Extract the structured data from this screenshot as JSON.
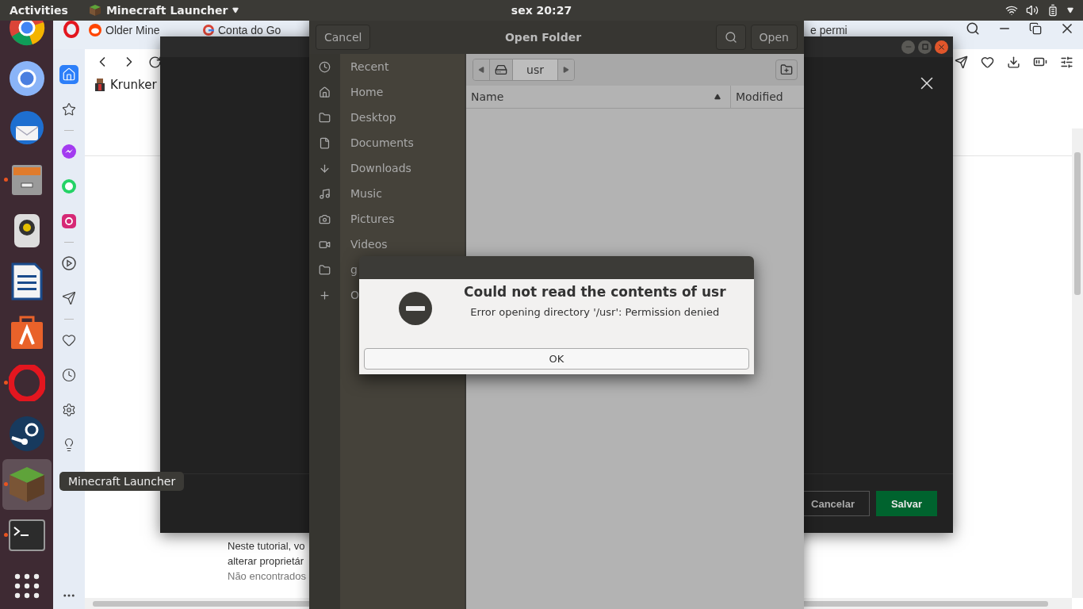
{
  "top_bar": {
    "activities": "Activities",
    "app_menu": "Minecraft Launcher",
    "clock": "sex 20:27"
  },
  "dock": {
    "apps": [
      {
        "kind": "chrome",
        "running": false,
        "selected": false
      },
      {
        "kind": "chromium",
        "running": false,
        "selected": false
      },
      {
        "kind": "mail",
        "running": false,
        "selected": false
      },
      {
        "kind": "files",
        "running": true,
        "selected": false
      },
      {
        "kind": "speaker",
        "running": false,
        "selected": false
      },
      {
        "kind": "writer",
        "running": false,
        "selected": false
      },
      {
        "kind": "store",
        "running": false,
        "selected": false
      },
      {
        "kind": "opera",
        "running": true,
        "selected": false
      },
      {
        "kind": "steam",
        "running": false,
        "selected": false
      },
      {
        "kind": "grass",
        "running": true,
        "selected": true
      },
      {
        "kind": "terminal",
        "running": true,
        "selected": false
      },
      {
        "kind": "grid",
        "running": false,
        "selected": false
      }
    ],
    "tooltip": "Minecraft Launcher"
  },
  "browser": {
    "tabs": [
      {
        "title": "Older Mine",
        "kind": "reddit"
      },
      {
        "title": "Conta do Go",
        "kind": "google"
      },
      {
        "title": "e permi",
        "kind": "plain"
      }
    ],
    "bookmark": "Krunker",
    "sidebar_groups": [
      [
        {
          "kind": "home",
          "selected": true
        },
        {
          "kind": "star",
          "selected": false
        }
      ],
      [
        {
          "kind": "messenger",
          "selected": false
        },
        {
          "kind": "whatsapp",
          "selected": false
        },
        {
          "kind": "instagram",
          "selected": false
        }
      ],
      [
        {
          "kind": "play",
          "selected": false
        },
        {
          "kind": "send",
          "selected": false
        }
      ],
      [
        {
          "kind": "heart",
          "selected": false
        },
        {
          "kind": "clock",
          "selected": false
        },
        {
          "kind": "gear",
          "selected": false
        },
        {
          "kind": "bulb",
          "selected": false
        }
      ]
    ],
    "article_lines": [
      "Neste tutorial, vo",
      "alterar proprietár",
      "Não encontrados"
    ]
  },
  "launcher_dialog": {
    "buttons": [
      {
        "label": "Cancelar",
        "kind": "secondary"
      },
      {
        "label": "Salvar",
        "kind": "primary"
      }
    ]
  },
  "file_chooser": {
    "title": "Open Folder",
    "cancel": "Cancel",
    "open": "Open",
    "path": [
      {
        "label": "usr",
        "selected": true
      }
    ],
    "columns": [
      "Name",
      "Modified"
    ],
    "places": [
      {
        "label": "Recent",
        "kind": "recent"
      },
      {
        "label": "Home",
        "kind": "home"
      },
      {
        "label": "Desktop",
        "kind": "folder"
      },
      {
        "label": "Documents",
        "kind": "file"
      },
      {
        "label": "Downloads",
        "kind": "download"
      },
      {
        "label": "Music",
        "kind": "music"
      },
      {
        "label": "Pictures",
        "kind": "camera"
      },
      {
        "label": "Videos",
        "kind": "video"
      },
      {
        "label": "g",
        "kind": "folder"
      },
      {
        "label": "O",
        "kind": "plus"
      }
    ]
  },
  "error_dialog": {
    "title": "Could not read the contents of usr",
    "message": "Error opening directory '/usr': Permission denied",
    "button": "OK"
  }
}
